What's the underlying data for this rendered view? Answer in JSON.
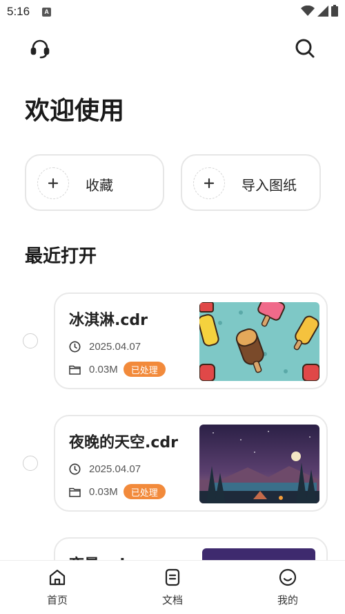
{
  "status": {
    "time": "5:16",
    "notification_letter": "A"
  },
  "header": {
    "support_icon": "headset-icon",
    "search_icon": "search-icon"
  },
  "welcome_title": "欢迎使用",
  "actions": [
    {
      "label": "收藏",
      "icon": "plus-icon"
    },
    {
      "label": "导入图纸",
      "icon": "plus-icon"
    }
  ],
  "recent": {
    "title": "最近打开",
    "files": [
      {
        "name": "冰淇淋.cdr",
        "date": "2025.04.07",
        "size": "0.03M",
        "status": "已处理",
        "thumb": "ice-cream-pattern"
      },
      {
        "name": "夜晚的天空.cdr",
        "date": "2025.04.07",
        "size": "0.03M",
        "status": "已处理",
        "thumb": "night-sky-camp"
      },
      {
        "name": "夜景.cdr",
        "thumb": "purple-night"
      }
    ]
  },
  "nav": [
    {
      "label": "首页",
      "icon": "home-icon"
    },
    {
      "label": "文档",
      "icon": "document-icon"
    },
    {
      "label": "我的",
      "icon": "smiley-profile-icon"
    }
  ],
  "colors": {
    "badge": "#f28a3b",
    "accent": "#222222"
  }
}
